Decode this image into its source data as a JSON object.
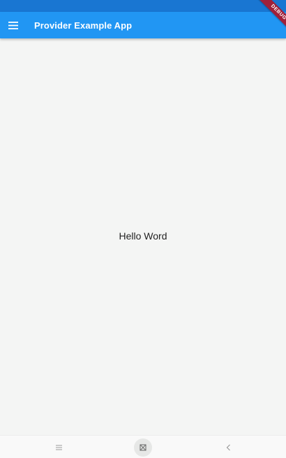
{
  "app_bar": {
    "title": "Provider Example App",
    "menu_icon": "hamburger-menu-icon",
    "color": "#2196f3"
  },
  "status_bar": {
    "color": "#1976d2"
  },
  "body": {
    "text": "Hello Word",
    "background": "#f4f5f4"
  },
  "debug_banner": {
    "label": "DEBUG",
    "color": "#a0203a"
  },
  "nav_bar": {
    "recents_icon": "recents-lines-icon",
    "home_icon": "home-icon",
    "back_icon": "back-chevron-icon"
  }
}
